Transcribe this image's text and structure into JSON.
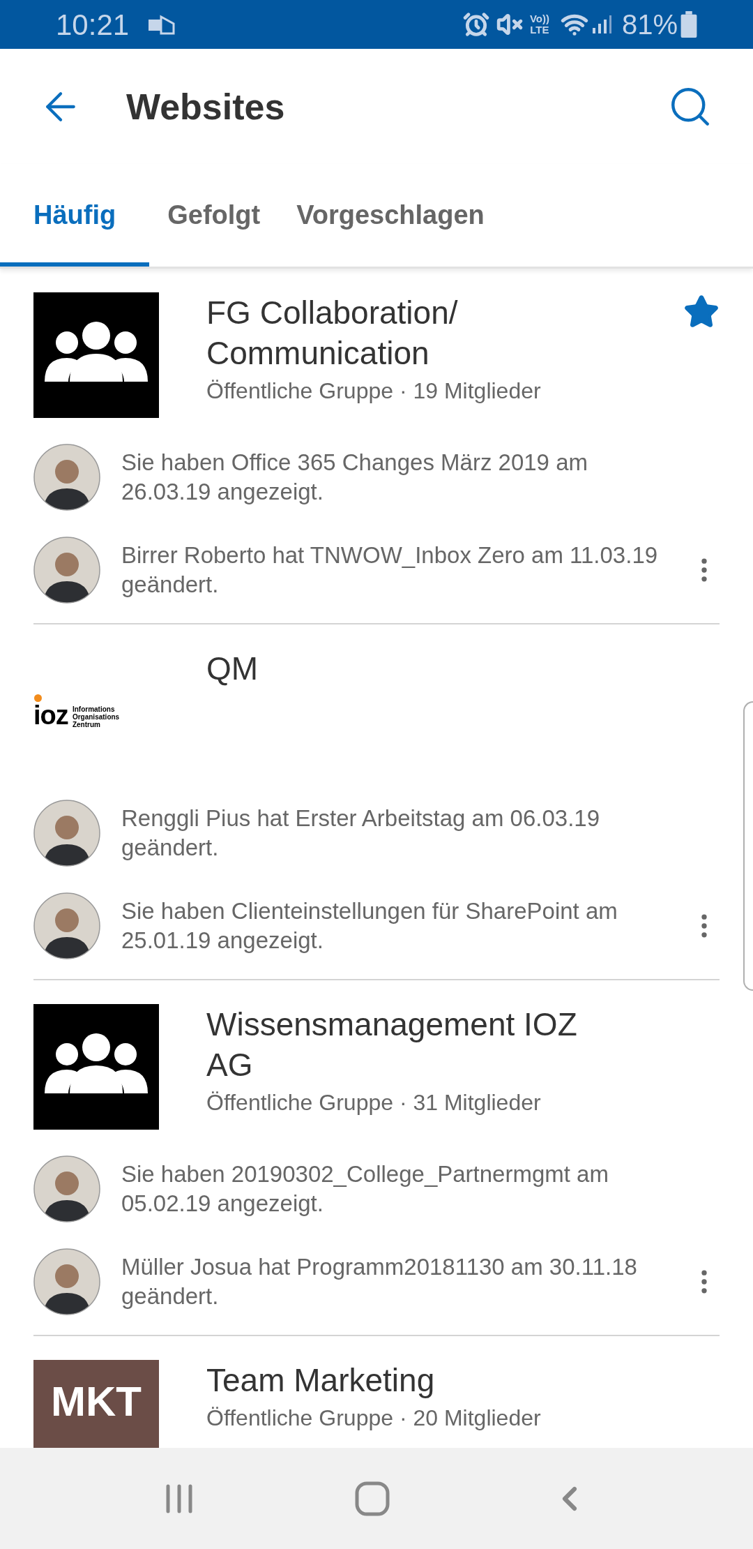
{
  "status_bar": {
    "time": "10:21",
    "volte_top": "Vo))",
    "volte_bottom": "LTE",
    "battery": "81%"
  },
  "header": {
    "title": "Websites"
  },
  "tabs": [
    {
      "label": "Häufig",
      "selected": true
    },
    {
      "label": "Gefolgt",
      "selected": false
    },
    {
      "label": "Vorgeschlagen",
      "selected": false
    }
  ],
  "sites": [
    {
      "title": "FG Collaboration/ Communication",
      "subtitle": "Öffentliche Gruppe · 19 Mitglieder",
      "favorite": true,
      "logo": {
        "kind": "group"
      },
      "activities": [
        "Sie haben Office 365 Changes März 2019 am 26.03.19 angezeigt.",
        "Birrer Roberto hat TNWOW_Inbox Zero am 11.03.19 geändert."
      ]
    },
    {
      "title": "QM",
      "favorite": false,
      "logo": {
        "kind": "ioz",
        "mark": "ioz",
        "lines": [
          "Informations",
          "Organisations",
          "Zentrum"
        ]
      },
      "activities": [
        "Renggli Pius hat Erster Arbeitstag am 06.03.19 geändert.",
        "Sie haben Clienteinstellungen für SharePoint am 25.01.19 angezeigt."
      ]
    },
    {
      "title": "Wissensmanagement IOZ AG",
      "subtitle": "Öffentliche Gruppe · 31 Mitglieder",
      "favorite": false,
      "logo": {
        "kind": "group"
      },
      "activities": [
        "Sie haben 20190302_College_Partnermgmt am 05.02.19 angezeigt.",
        "Müller Josua hat Programm20181130 am 30.11.18 geändert."
      ]
    },
    {
      "title": "Team Marketing",
      "subtitle": "Öffentliche Gruppe · 20 Mitglieder",
      "favorite": false,
      "logo": {
        "kind": "text",
        "mark": "MKT"
      }
    }
  ]
}
